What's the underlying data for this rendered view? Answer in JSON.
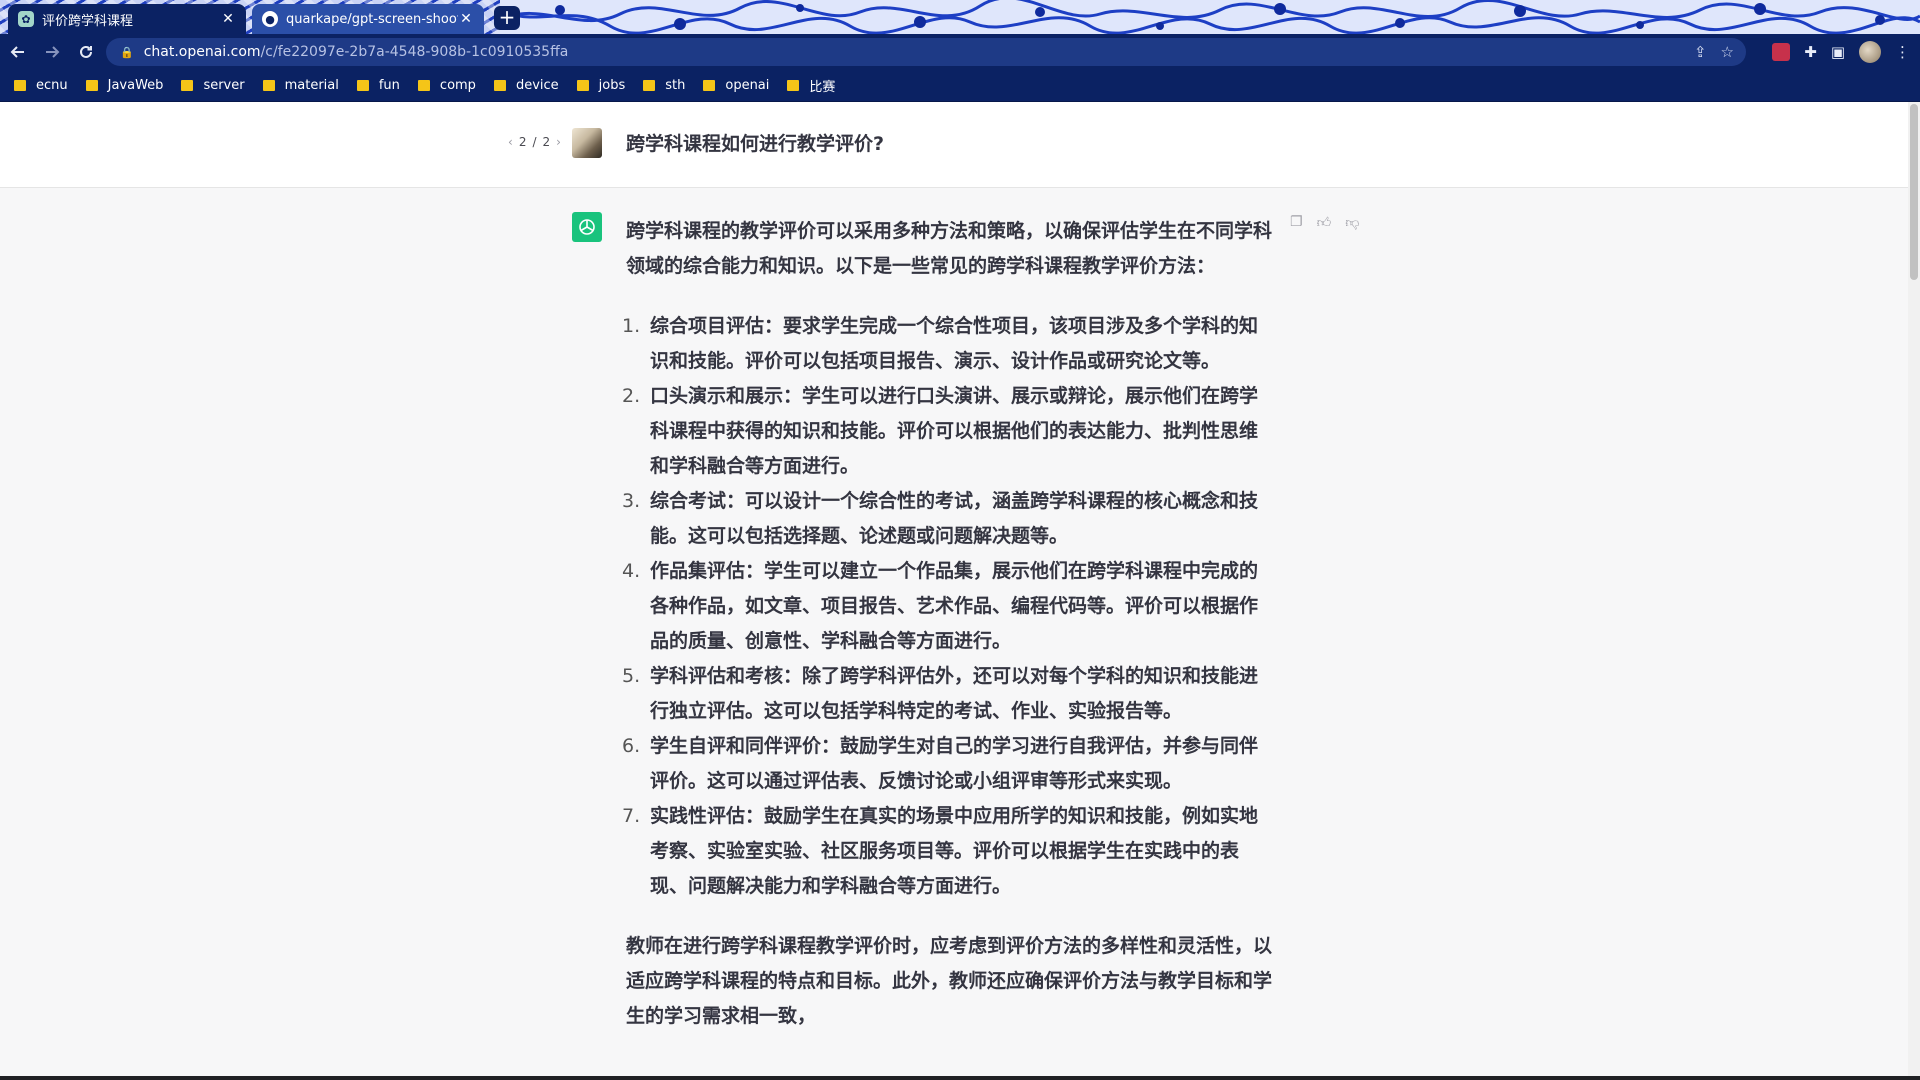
{
  "browser": {
    "tabs": [
      {
        "title": "评价跨学科课程",
        "active": true,
        "favicon": "chatgpt-favicon-icon"
      },
      {
        "title": "quarkape/gpt-screen-shooter",
        "active": false,
        "favicon": "github-icon"
      }
    ],
    "new_tab_label": "+",
    "url_host": "chat.openai.com",
    "url_path": "/c/fe22097e-2b7a-4548-908b-1c0910535ffa",
    "bookmarks": [
      "ecnu",
      "JavaWeb",
      "server",
      "material",
      "fun",
      "comp",
      "device",
      "jobs",
      "sth",
      "openai",
      "比赛"
    ]
  },
  "conversation": {
    "pager": {
      "current": "2",
      "separator": "/",
      "total": "2"
    },
    "user_message": "跨学科课程如何进行教学评价?",
    "assistant": {
      "intro": "跨学科课程的教学评价可以采用多种方法和策略，以确保评估学生在不同学科领域的综合能力和知识。以下是一些常见的跨学科课程教学评价方法：",
      "items": [
        {
          "num": "1.",
          "text": "综合项目评估：要求学生完成一个综合性项目，该项目涉及多个学科的知识和技能。评价可以包括项目报告、演示、设计作品或研究论文等。"
        },
        {
          "num": "2.",
          "text": "口头演示和展示：学生可以进行口头演讲、展示或辩论，展示他们在跨学科课程中获得的知识和技能。评价可以根据他们的表达能力、批判性思维和学科融合等方面进行。"
        },
        {
          "num": "3.",
          "text": "综合考试：可以设计一个综合性的考试，涵盖跨学科课程的核心概念和技能。这可以包括选择题、论述题或问题解决题等。"
        },
        {
          "num": "4.",
          "text": "作品集评估：学生可以建立一个作品集，展示他们在跨学科课程中完成的各种作品，如文章、项目报告、艺术作品、编程代码等。评价可以根据作品的质量、创意性、学科融合等方面进行。"
        },
        {
          "num": "5.",
          "text": "学科评估和考核：除了跨学科评估外，还可以对每个学科的知识和技能进行独立评估。这可以包括学科特定的考试、作业、实验报告等。"
        },
        {
          "num": "6.",
          "text": "学生自评和同伴评价：鼓励学生对自己的学习进行自我评估，并参与同伴评价。这可以通过评估表、反馈讨论或小组评审等形式来实现。"
        },
        {
          "num": "7.",
          "text": "实践性评估：鼓励学生在真实的场景中应用所学的知识和技能，例如实地考察、实验室实验、社区服务项目等。评价可以根据学生在实践中的表现、问题解决能力和学科融合等方面进行。"
        }
      ],
      "conclusion": "教师在进行跨学科课程教学评价时，应考虑到评价方法的多样性和灵活性，以适应跨学科课程的特点和目标。此外，教师还应确保评价方法与教学目标和学生的学习需求相一致，"
    }
  },
  "colors": {
    "chrome_bg": "#0b2263",
    "accent_green": "#19c37d",
    "text": "#343541"
  }
}
